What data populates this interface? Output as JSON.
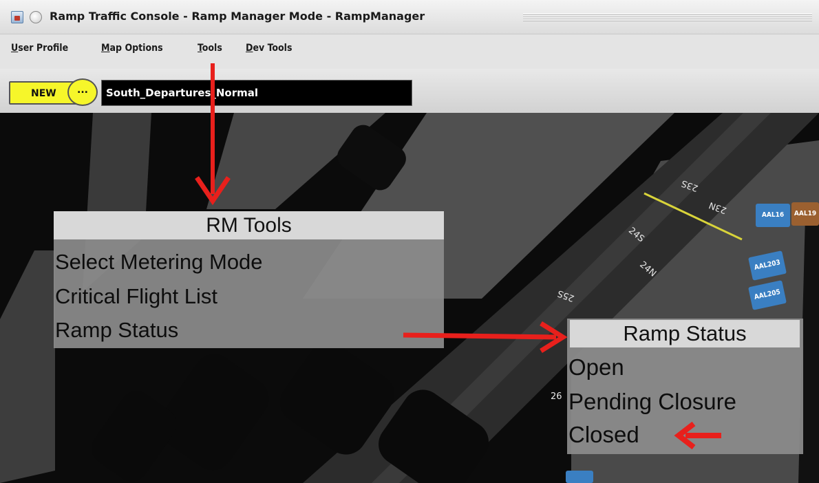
{
  "window": {
    "title": "Ramp Traffic Console - Ramp Manager Mode - RampManager",
    "app_icon": "java-app-icon",
    "window_button": "window-menu-icon"
  },
  "menubar": {
    "items": [
      {
        "label": "User Profile",
        "mnemonic": "U"
      },
      {
        "label": "Map Options",
        "mnemonic": "M"
      },
      {
        "label": "Tools",
        "mnemonic": "T"
      },
      {
        "label": "Dev Tools",
        "mnemonic": "D"
      }
    ]
  },
  "toolbar": {
    "new_label": "NEW",
    "more_label": "...",
    "config_name": "South_Departures_Normal",
    "accent": "#f6f62a"
  },
  "map": {
    "gates": [
      "23S",
      "23N",
      "24S",
      "24N",
      "25S",
      "26"
    ],
    "flights": [
      {
        "callsign": "AAL16",
        "color": "#3a7fc2"
      },
      {
        "callsign": "AAL19",
        "color": "#9b6030"
      },
      {
        "callsign": "AAL203",
        "color": "#3a7fc2"
      },
      {
        "callsign": "AAL205",
        "color": "#3a7fc2"
      }
    ]
  },
  "rm_tools": {
    "title": "RM Tools",
    "items": [
      "Select Metering Mode",
      "Critical Flight  List",
      "Ramp Status"
    ]
  },
  "ramp_status": {
    "title": "Ramp  Status",
    "items": [
      "Open",
      "Pending  Closure",
      "Closed"
    ]
  },
  "annotation_color": "#e8201c"
}
